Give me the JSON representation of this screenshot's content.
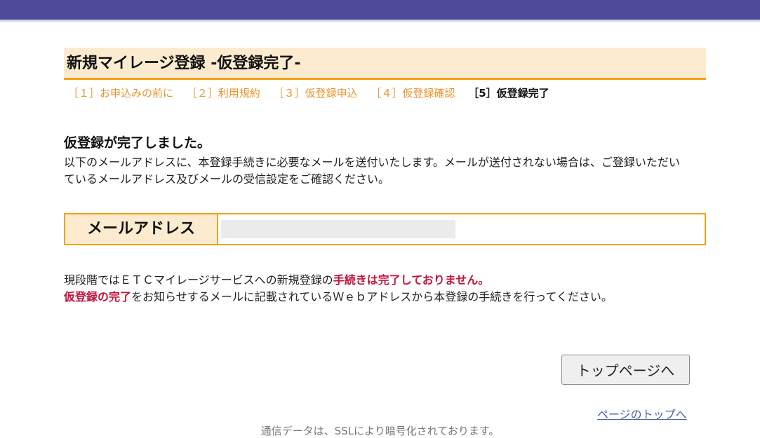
{
  "header": {
    "title": "新規マイレージ登録 -仮登録完了-"
  },
  "steps": [
    {
      "label": "［１］お申込みの前に"
    },
    {
      "label": "［２］利用規約"
    },
    {
      "label": "［３］仮登録申込"
    },
    {
      "label": "［４］仮登録確認"
    },
    {
      "label": "［5］仮登録完了"
    }
  ],
  "complete": {
    "heading": "仮登録が完了しました。",
    "description": "以下のメールアドレスに、本登録手続きに必要なメールを送付いたします。メールが送付されない場合は、ご登録いただいているメールアドレス及びメールの受信設定をご確認ください。"
  },
  "mail": {
    "label": "メールアドレス",
    "value": ""
  },
  "notice": {
    "line1_prefix": "現段階ではＥＴＣマイレージサービスへの新規登録の",
    "line1_emph": "手続きは完了しておりません。",
    "line2_emph": "仮登録の完了",
    "line2_suffix": "をお知らせするメールに記載されているＷｅｂアドレスから本登録の手続きを行ってください。"
  },
  "buttons": {
    "top_page": "トップページへ"
  },
  "links": {
    "page_top": "ページのトップへ"
  },
  "footer": {
    "ssl_note": "通信データは、SSLにより暗号化されております。"
  },
  "colors": {
    "header_bar": "#4f4a9a",
    "accent_orange": "#f5a11a",
    "title_bg": "#fdebcf",
    "emphasis_red": "#c0143c",
    "link_blue": "#4a62a6"
  }
}
